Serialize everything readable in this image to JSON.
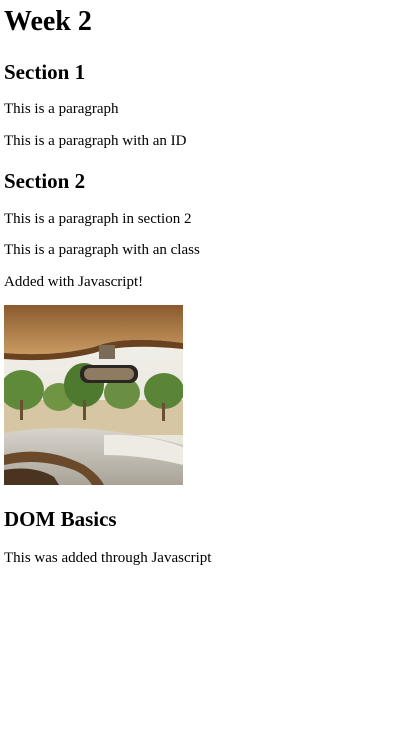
{
  "heading": "Week 2",
  "section1": {
    "title": "Section 1",
    "paragraph": "This is a paragraph",
    "paragraph_id": "This is a paragraph with an ID"
  },
  "section2": {
    "title": "Section 2",
    "paragraph": "This is a paragraph in section 2",
    "paragraph_class": "This is a paragraph with an class",
    "added": "Added with Javascript!"
  },
  "dom": {
    "title": "DOM Basics",
    "paragraph": "This was added through Javascript"
  }
}
